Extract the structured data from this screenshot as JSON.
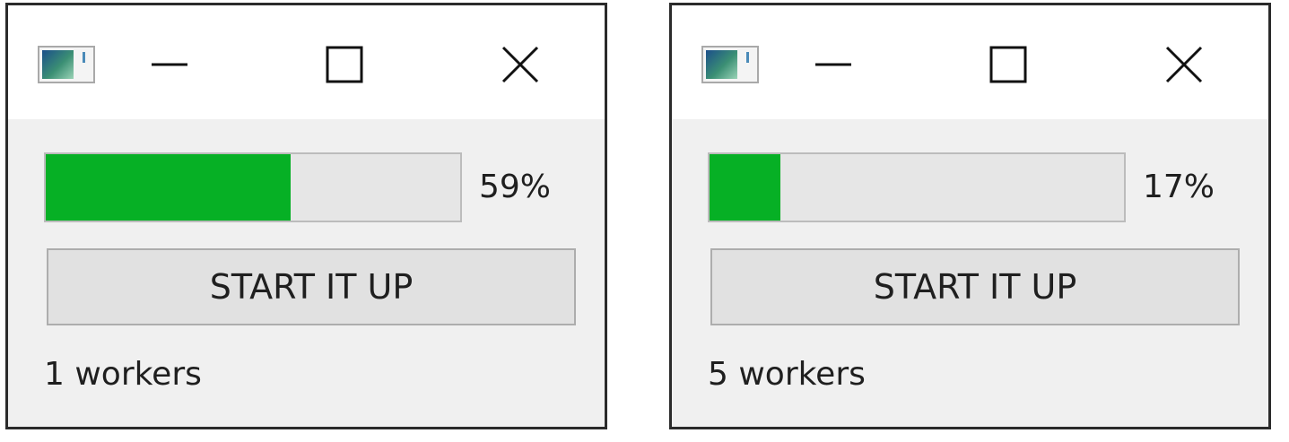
{
  "windows": [
    {
      "progress": {
        "percent": 59,
        "label": "59%"
      },
      "button_label": "START IT UP",
      "workers_label": "1 workers"
    },
    {
      "progress": {
        "percent": 17,
        "label": "17%"
      },
      "button_label": "START IT UP",
      "workers_label": "5 workers"
    }
  ],
  "colors": {
    "progress_fill": "#06b025",
    "progress_track": "#e6e6e6",
    "window_body": "#f0f0f0",
    "titlebar": "#ffffff"
  },
  "icons": {
    "app": "app-window-icon",
    "minimize": "minimize-icon",
    "maximize": "maximize-icon",
    "close": "close-icon"
  }
}
